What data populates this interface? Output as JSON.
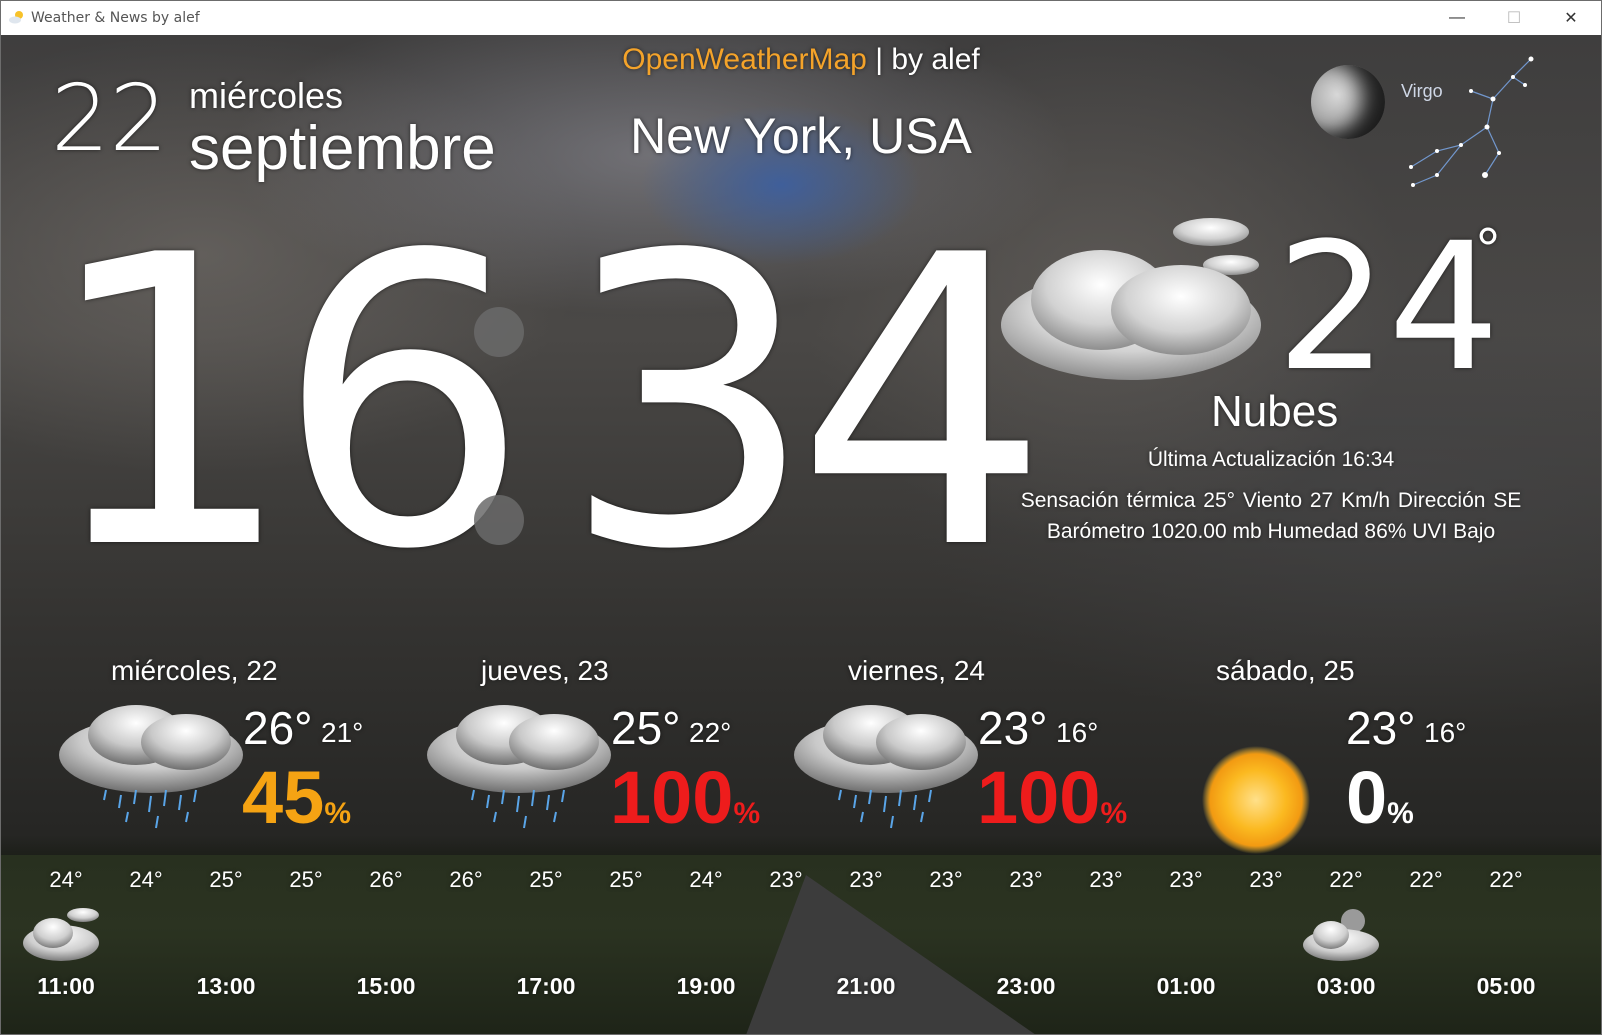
{
  "window": {
    "title": "Weather & News by alef",
    "minimize": "—",
    "maximize": "☐",
    "close": "✕"
  },
  "header": {
    "source_name": "OpenWeatherMap",
    "source_by": " | by alef",
    "city": "New York, USA"
  },
  "date": {
    "day": "22",
    "weekday": "miércoles",
    "month": "septiembre"
  },
  "clock": {
    "hours": "16",
    "minutes": "34"
  },
  "astro": {
    "zodiac": "Virgo",
    "moon_icon": "moon-phase-icon",
    "constellation_icon": "virgo-constellation-icon"
  },
  "current": {
    "temperature": "24",
    "degree": "°",
    "description": "Nubes",
    "icon": "cloudy-icon",
    "updated": "Última Actualización 16:34",
    "details_line1": "Sensación térmica 25°   Viento 27 Km/h   Dirección SE",
    "details_line2": "Barómetro 1020.00 mb   Humedad 86%   UVI Bajo"
  },
  "forecast": [
    {
      "day": "miércoles, 22",
      "high": "26°",
      "low": "21°",
      "pop": "45",
      "pct": "%",
      "pop_color": "#f5a313",
      "icon": "rain-cloud-icon"
    },
    {
      "day": "jueves, 23",
      "high": "25°",
      "low": "22°",
      "pop": "100",
      "pct": "%",
      "pop_color": "#ee1c1c",
      "icon": "rain-cloud-icon"
    },
    {
      "day": "viernes, 24",
      "high": "23°",
      "low": "16°",
      "pop": "100",
      "pct": "%",
      "pop_color": "#ee1c1c",
      "icon": "rain-cloud-icon"
    },
    {
      "day": "sábado, 25",
      "high": "23°",
      "low": "16°",
      "pop": "0",
      "pct": "%",
      "pop_color": "#ffffff",
      "icon": "sun-icon"
    }
  ],
  "hourly": {
    "temps": [
      "24°",
      "24°",
      "25°",
      "25°",
      "26°",
      "26°",
      "25°",
      "25°",
      "24°",
      "23°",
      "23°",
      "23°",
      "23°",
      "23°",
      "23°",
      "23°",
      "22°",
      "22°",
      "22°"
    ],
    "labels": [
      "11:00",
      "13:00",
      "15:00",
      "17:00",
      "19:00",
      "21:00",
      "23:00",
      "01:00",
      "03:00",
      "05:00"
    ],
    "icons": [
      "cloudy-icon",
      "night-cloud-icon"
    ]
  }
}
